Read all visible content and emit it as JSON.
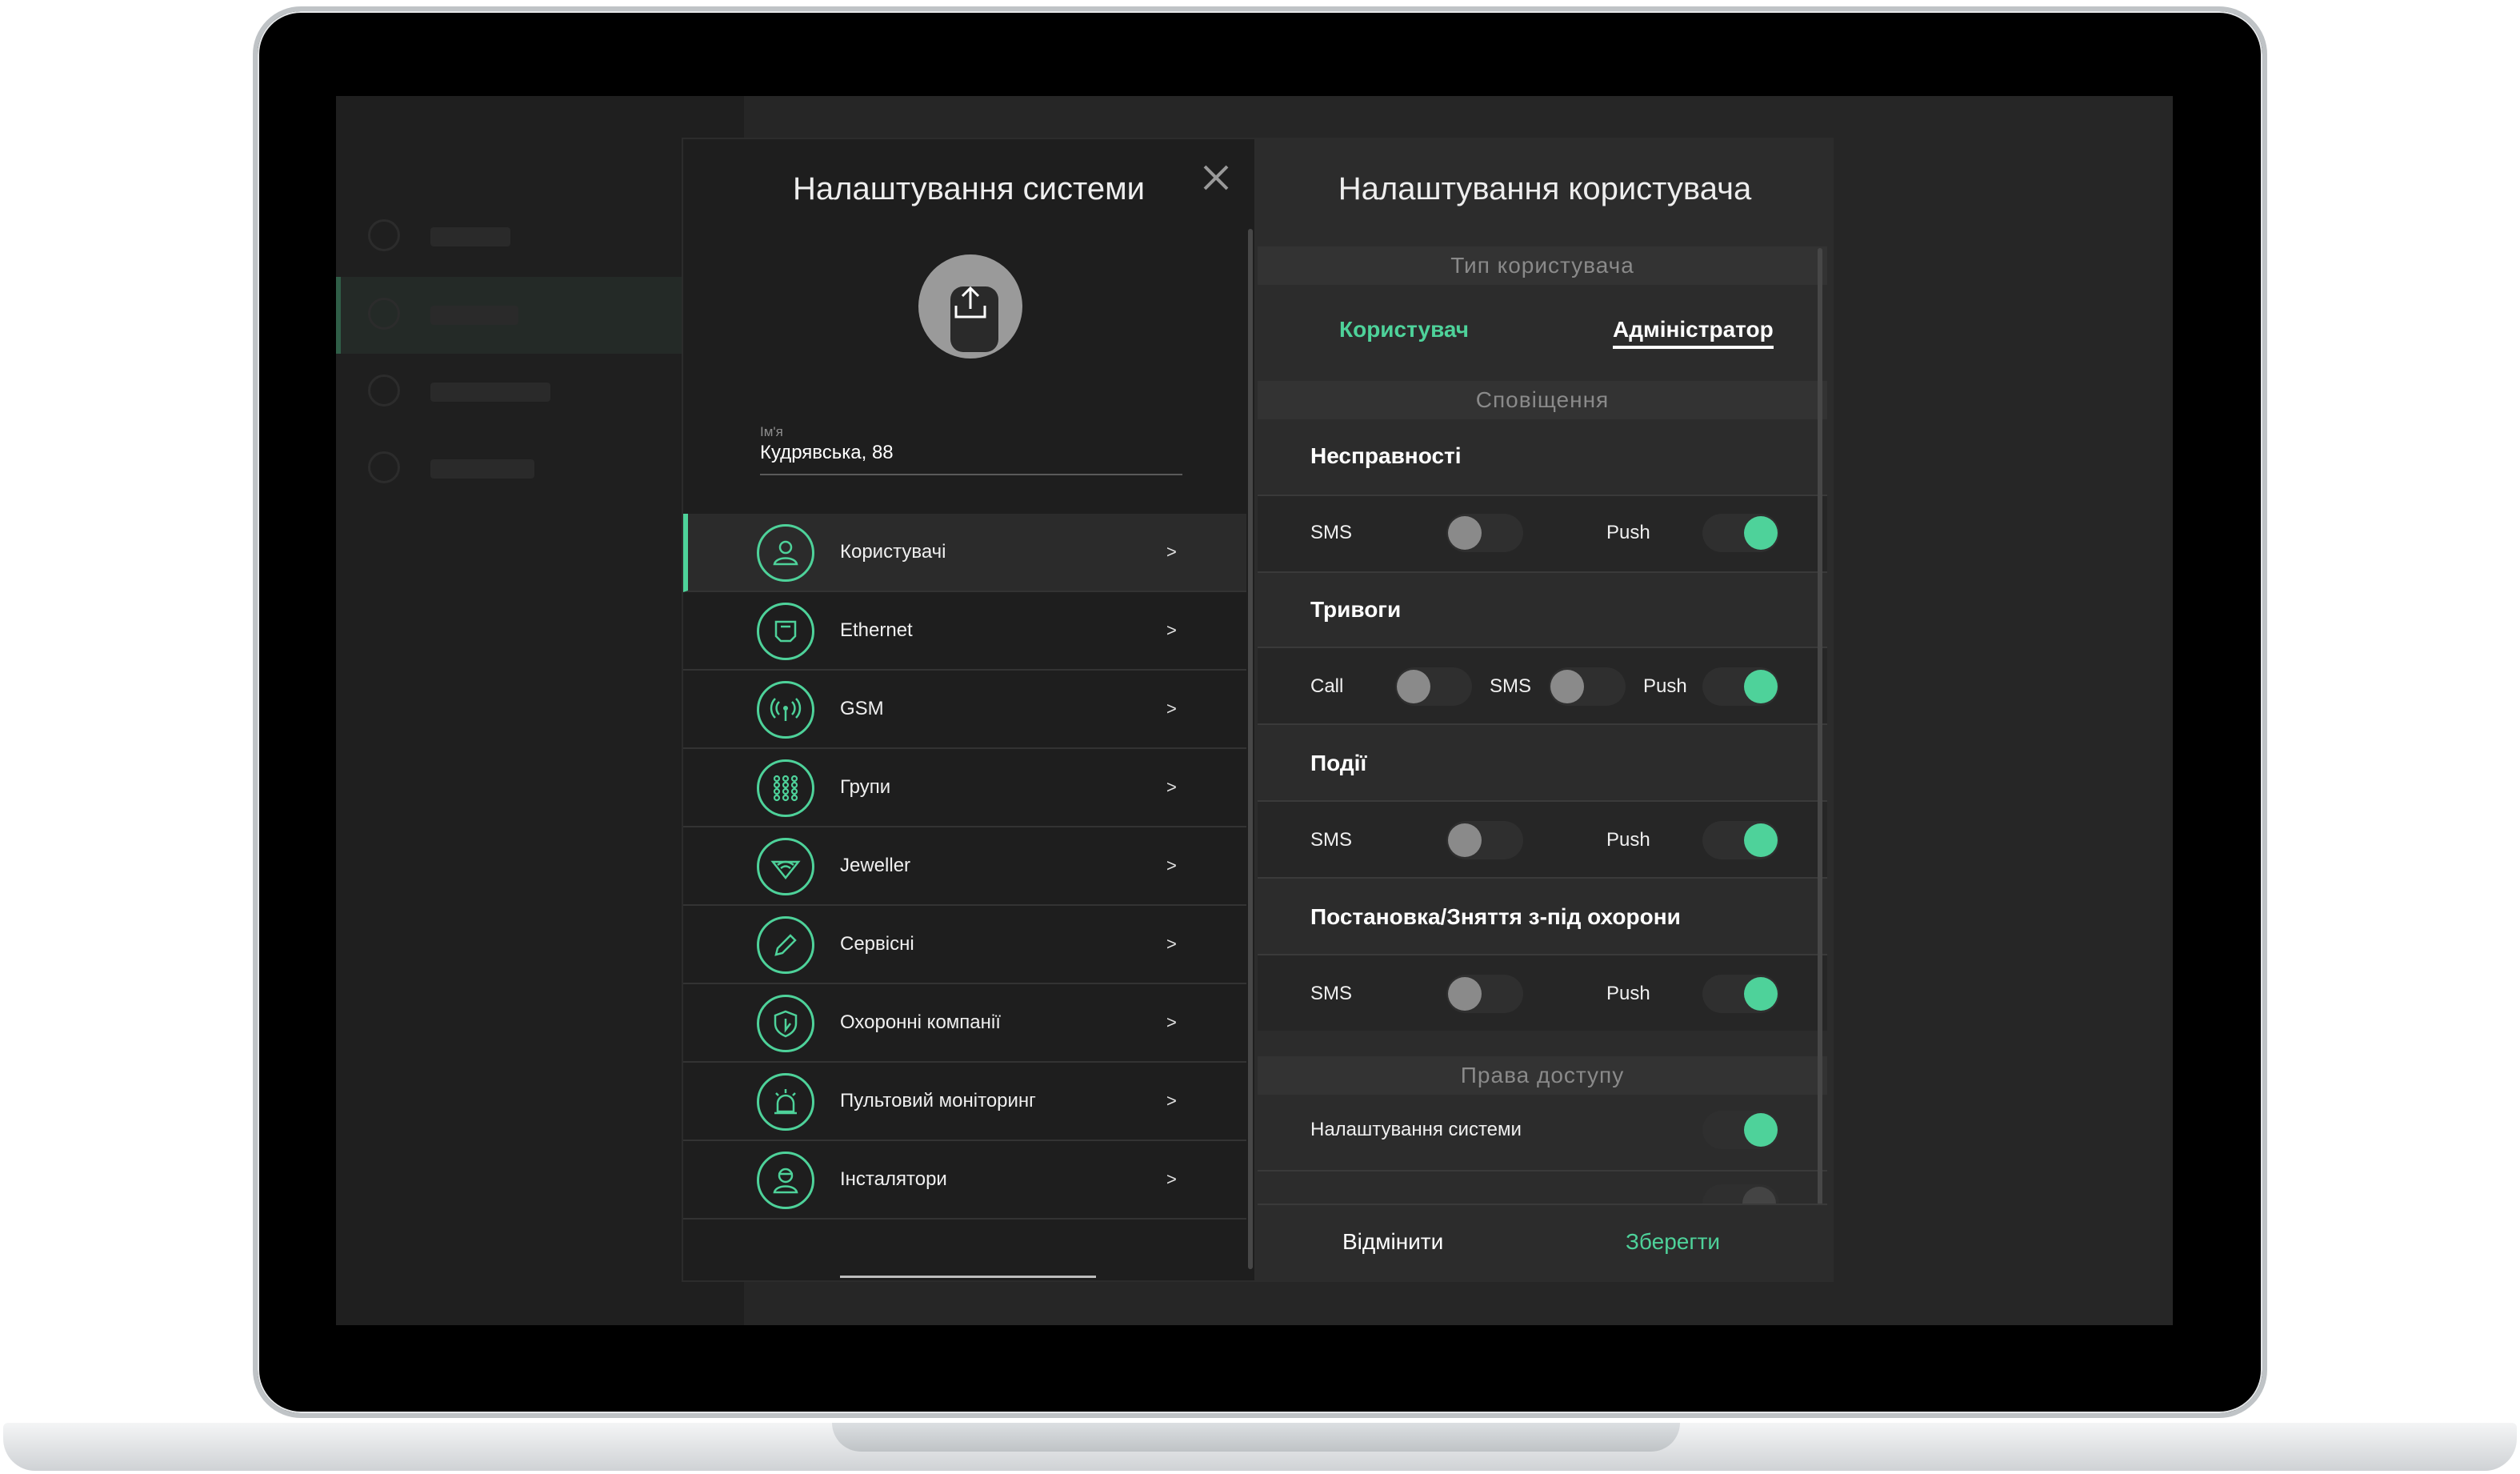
{
  "left_panel": {
    "title": "Налаштування системи",
    "name_label": "Ім'я",
    "name_value": "Кудрявська, 88",
    "menu": [
      {
        "label": "Користувачі",
        "arrow": ">",
        "icon": "user-icon"
      },
      {
        "label": "Ethernet",
        "arrow": ">",
        "icon": "ethernet-icon"
      },
      {
        "label": "GSM",
        "arrow": ">",
        "icon": "antenna-icon"
      },
      {
        "label": "Групи",
        "arrow": ">",
        "icon": "grid-icon"
      },
      {
        "label": "Jeweller",
        "arrow": ">",
        "icon": "wifi-diamond-icon"
      },
      {
        "label": "Сервісні",
        "arrow": ">",
        "icon": "pencil-icon"
      },
      {
        "label": "Охоронні компанії",
        "arrow": ">",
        "icon": "shield-icon"
      },
      {
        "label": "Пультовий моніторинг",
        "arrow": ">",
        "icon": "siren-icon"
      },
      {
        "label": "Інсталятори",
        "arrow": ">",
        "icon": "installer-icon"
      }
    ]
  },
  "right_panel": {
    "title": "Налаштування користувача",
    "user_type_header": "Тип користувача",
    "user_type_user": "Користувач",
    "user_type_admin": "Адміністратор",
    "notifications_header": "Сповіщення",
    "malfunctions": {
      "title": "Несправності",
      "sms": "SMS",
      "push": "Push",
      "sms_on": false,
      "push_on": true
    },
    "alarms": {
      "title": "Тривоги",
      "call": "Call",
      "sms": "SMS",
      "push": "Push",
      "call_on": false,
      "sms_on": false,
      "push_on": true
    },
    "events": {
      "title": "Події",
      "sms": "SMS",
      "push": "Push",
      "sms_on": false,
      "push_on": true
    },
    "arming": {
      "title": "Постановка/Зняття з-під охорони",
      "sms": "SMS",
      "push": "Push",
      "sms_on": false,
      "push_on": true
    },
    "access_header": "Права доступу",
    "access_system_settings": {
      "label": "Налаштування системи",
      "on": true
    },
    "cancel": "Відмінити",
    "save": "Зберегти"
  },
  "colors": {
    "accent": "#4ed29a",
    "panel_dark": "#1e1e1e",
    "panel": "#2c2c2c"
  }
}
